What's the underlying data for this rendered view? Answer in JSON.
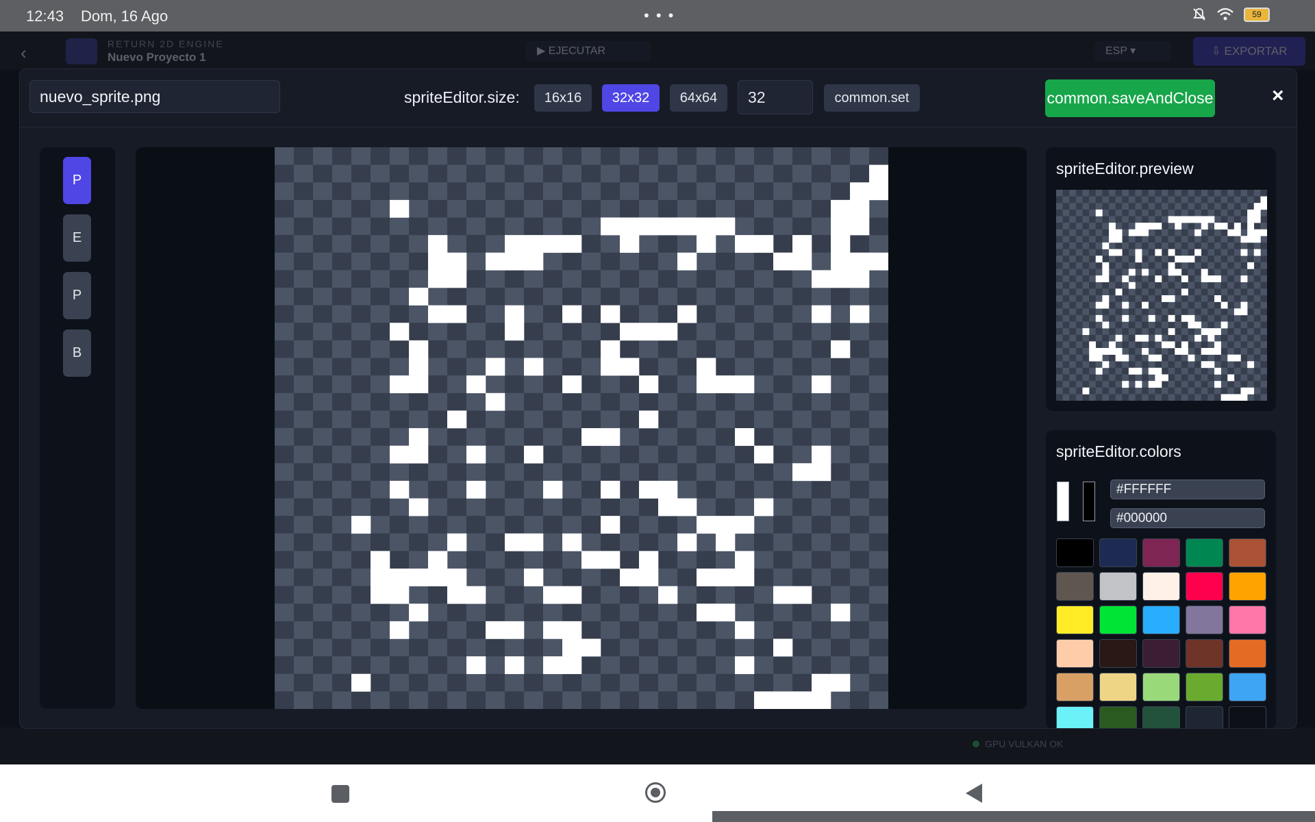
{
  "status_bar": {
    "time": "12:43",
    "date": "Dom, 16 Ago",
    "battery": "59"
  },
  "app_header": {
    "brand": "RETURN 2D ENGINE",
    "project": "Nuevo Proyecto 1",
    "run_label": "EJECUTAR",
    "lang_label": "ESP",
    "export_label": "EXPORTAR"
  },
  "status_footer": {
    "gpu": "GPU VULKAN OK"
  },
  "editor": {
    "filename": "nuevo_sprite.png",
    "size_label": "spriteEditor.size:",
    "size_options": [
      "16x16",
      "32x32",
      "64x64"
    ],
    "selected_size": "32x32",
    "size_input": "32",
    "set_label": "common.set",
    "save_label": "common.saveAndClose",
    "close_label": "×",
    "tools": [
      "P",
      "E",
      "P",
      "B"
    ],
    "active_tool": 0
  },
  "preview": {
    "title": "spriteEditor.preview"
  },
  "colors": {
    "title": "spriteEditor.colors",
    "primary": "#FFFFFF",
    "secondary": "#000000",
    "palette": [
      "#000000",
      "#1d2b53",
      "#7e2553",
      "#008751",
      "#ab5236",
      "#5f574f",
      "#c2c3c7",
      "#fff1e8",
      "#ff004d",
      "#ffa300",
      "#ffec27",
      "#00e436",
      "#29adff",
      "#83769c",
      "#ff77a8",
      "#ffccaa",
      "#291814",
      "#3b1d34",
      "#6f3428",
      "#e36b24",
      "#d9a066",
      "#eed585",
      "#99d97a",
      "#6aab2f",
      "#3ea5f5",
      "#6bf2f8",
      "#2b5a20",
      "#23523c",
      "#1e2633",
      "#0d1017"
    ]
  },
  "sprite": {
    "grid_size": 32,
    "rows": [
      "................................",
      "...............................X",
      "..............................XX",
      "......X......................XX.",
      ".................XXXXXXX.....XX..",
      "........X...XXXX..X...X.XX.X.X..",
      "........XX.XXX.......X....XX.XXX",
      "........XX..................XXX.",
      ".......X........................",
      "........XX..X..X.X...X......X.X.",
      "......X.....X.....XXX...........",
      ".......X.........X...........X..",
      ".......X...X.X...XX...X.........",
      "......XX..X....X...X..XXX...X...",
      "...........X....................",
      ".........X.........X............",
      ".......X........XX......X.......",
      "......XX..X..X...........X..X...",
      "...........................XX...",
      "......X...X...X..X.XX...........",
      ".......X............XX...X......",
      "....X............X....XXX.......",
      ".........X..XX.X.....X.X........",
      ".....X..X.......XX.X....X.......",
      ".....XXXXX...X....XX..XXX.......",
      ".....XX..XX...XX....X.....XX....",
      ".......X..............XX.....X..",
      "......X....XX.XX........X.......",
      "...............XX.........X.....",
      "..........X.X.XX........X.......",
      "....X.......................XX..",
      ".........................XXXX..."
    ]
  }
}
